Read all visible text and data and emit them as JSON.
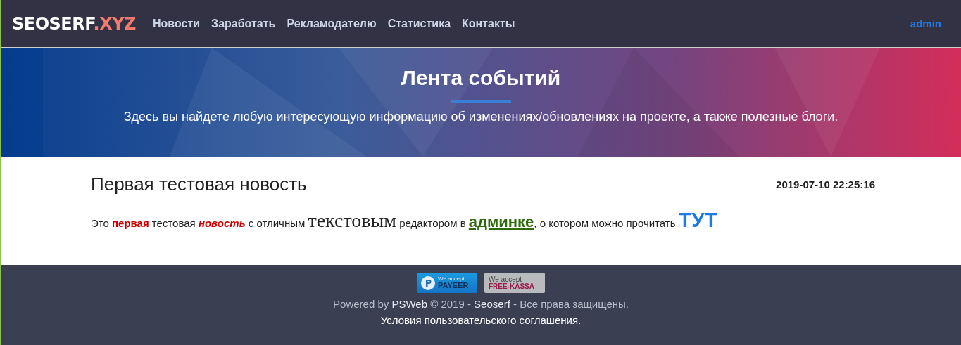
{
  "navbar": {
    "logo": {
      "main": "SEOSERF",
      "accent": ".XYZ"
    },
    "links": [
      {
        "label": "Новости"
      },
      {
        "label": "Заработать"
      },
      {
        "label": "Рекламодателю"
      },
      {
        "label": "Статистика"
      },
      {
        "label": "Контакты"
      }
    ],
    "user": "admin"
  },
  "hero": {
    "title": "Лента событий",
    "subtitle": "Здесь вы найдете любую интересующую информацию об изменениях/обновлениях на проекте, а также полезные блоги."
  },
  "post": {
    "title": "Первая тестовая новость",
    "date": "2019-07-10 22:25:16",
    "segments": [
      {
        "kind": "plain",
        "text": "Это "
      },
      {
        "kind": "red-bold",
        "text": "первая"
      },
      {
        "kind": "plain",
        "text": " тестовая "
      },
      {
        "kind": "red-bold-italic",
        "text": "новость"
      },
      {
        "kind": "plain",
        "text": " с отличным "
      },
      {
        "kind": "serif-large",
        "text": "текстовым"
      },
      {
        "kind": "plain",
        "text": " редактором в "
      },
      {
        "kind": "green-link",
        "text": "админке"
      },
      {
        "kind": "plain",
        "text": ", о котором "
      },
      {
        "kind": "underline",
        "text": "можно"
      },
      {
        "kind": "plain",
        "text": " прочитать "
      },
      {
        "kind": "blue-link",
        "text": "ТУТ"
      }
    ]
  },
  "footer": {
    "badges": [
      {
        "kind": "payeer",
        "top": "We accept",
        "bottom": "PAYEER"
      },
      {
        "kind": "freekassa",
        "top": "We accept",
        "bottom": "FREE-KASSA"
      }
    ],
    "copyright": [
      {
        "kind": "plain",
        "text": "Powered by "
      },
      {
        "kind": "link",
        "text": "PSWeb"
      },
      {
        "kind": "plain",
        "text": " © 2019 - "
      },
      {
        "kind": "link",
        "text": "Seoserf"
      },
      {
        "kind": "plain",
        "text": " - Все права защищены."
      }
    ],
    "terms": "Условия пользовательского соглашения."
  }
}
